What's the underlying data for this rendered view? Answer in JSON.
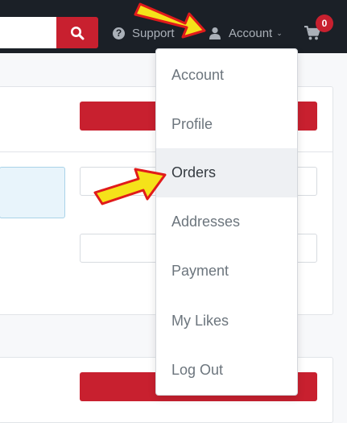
{
  "header": {
    "support_label": "Support",
    "account_label": "Account",
    "cart_count": "0"
  },
  "menu": {
    "items": [
      {
        "label": "Account",
        "active": false
      },
      {
        "label": "Profile",
        "active": false
      },
      {
        "label": "Orders",
        "active": true
      },
      {
        "label": "Addresses",
        "active": false
      },
      {
        "label": "Payment",
        "active": false
      },
      {
        "label": "My Likes",
        "active": false
      },
      {
        "label": "Log Out",
        "active": false
      }
    ]
  },
  "colors": {
    "topbar": "#1b2027",
    "accent": "#c8202f",
    "arrow_fill": "#f5e21a",
    "arrow_stroke": "#e01b1b"
  },
  "icons": [
    "search-icon",
    "question-circle-icon",
    "user-icon",
    "chevron-down-icon",
    "shopping-cart-icon",
    "annotation-arrow-icon"
  ]
}
